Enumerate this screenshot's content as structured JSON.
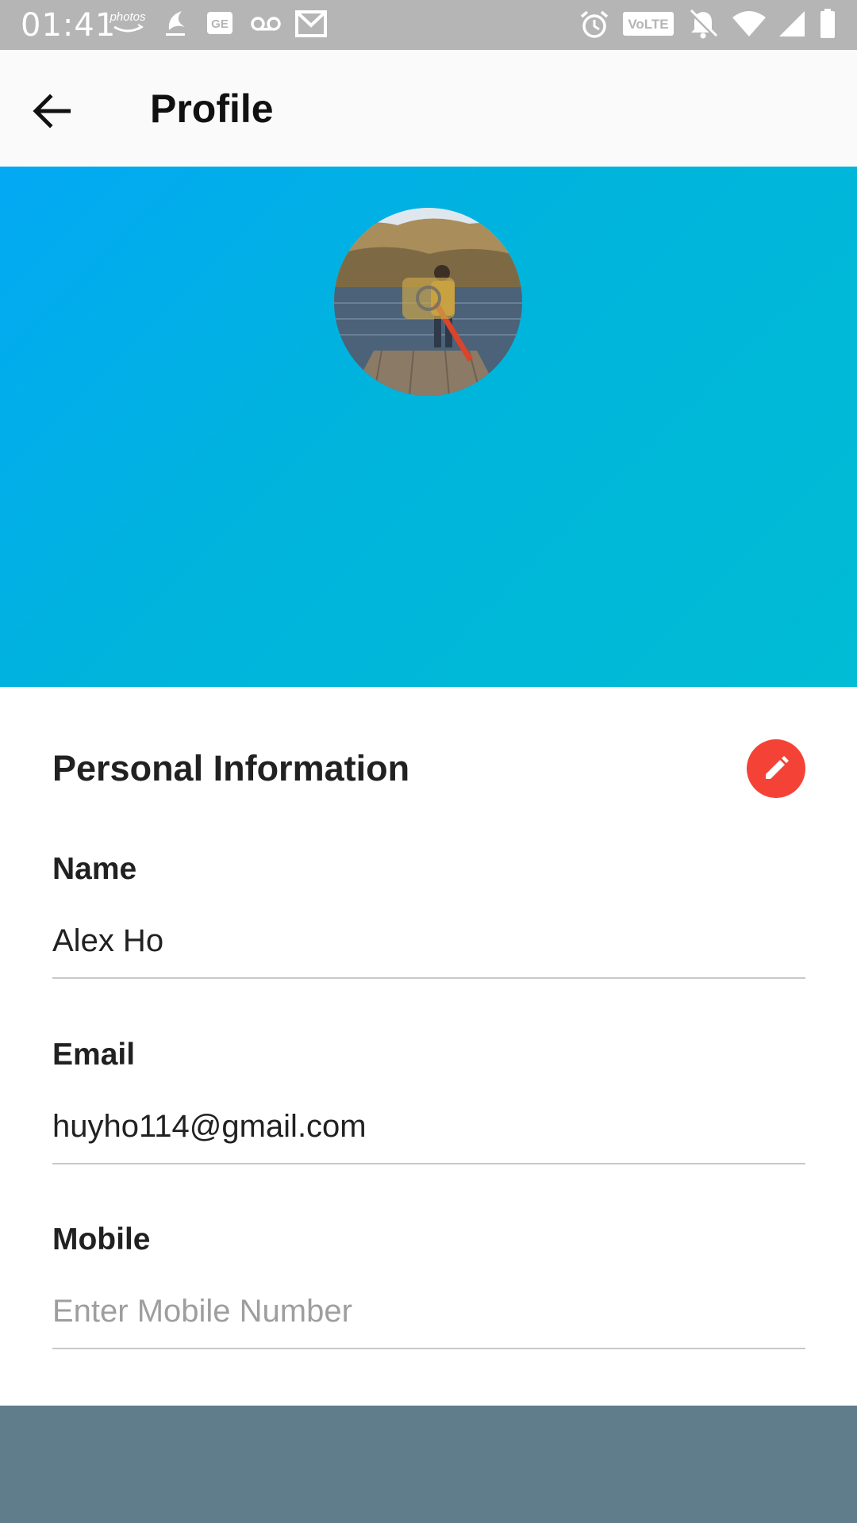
{
  "status_bar": {
    "time": "01:41",
    "left_icons": [
      "amazon-photos-icon",
      "moon-app-icon",
      "ge-icon",
      "voicemail-icon",
      "gmail-icon"
    ],
    "right_icons": [
      "alarm-icon",
      "volte-icon",
      "notifications-off-icon",
      "wifi-icon",
      "signal-icon",
      "battery-icon"
    ],
    "photos_text": "photos",
    "ge_text": "GE",
    "volte_text": "VoLTE"
  },
  "app_bar": {
    "title": "Profile",
    "back_icon": "arrow-back-icon"
  },
  "hero": {
    "gradient_start": "#03a9f4",
    "gradient_end": "#00bcd4",
    "avatar_alt": "profile-photo"
  },
  "personal_info": {
    "title": "Personal Information",
    "edit_icon": "pencil-icon",
    "edit_color": "#f44336",
    "fields": [
      {
        "label": "Name",
        "value": "Alex Ho",
        "placeholder": ""
      },
      {
        "label": "Email",
        "value": "huyho114@gmail.com",
        "placeholder": ""
      },
      {
        "label": "Mobile",
        "value": "",
        "placeholder": "Enter Mobile Number"
      }
    ]
  },
  "bottom_bar": {
    "color": "#607d8b"
  }
}
